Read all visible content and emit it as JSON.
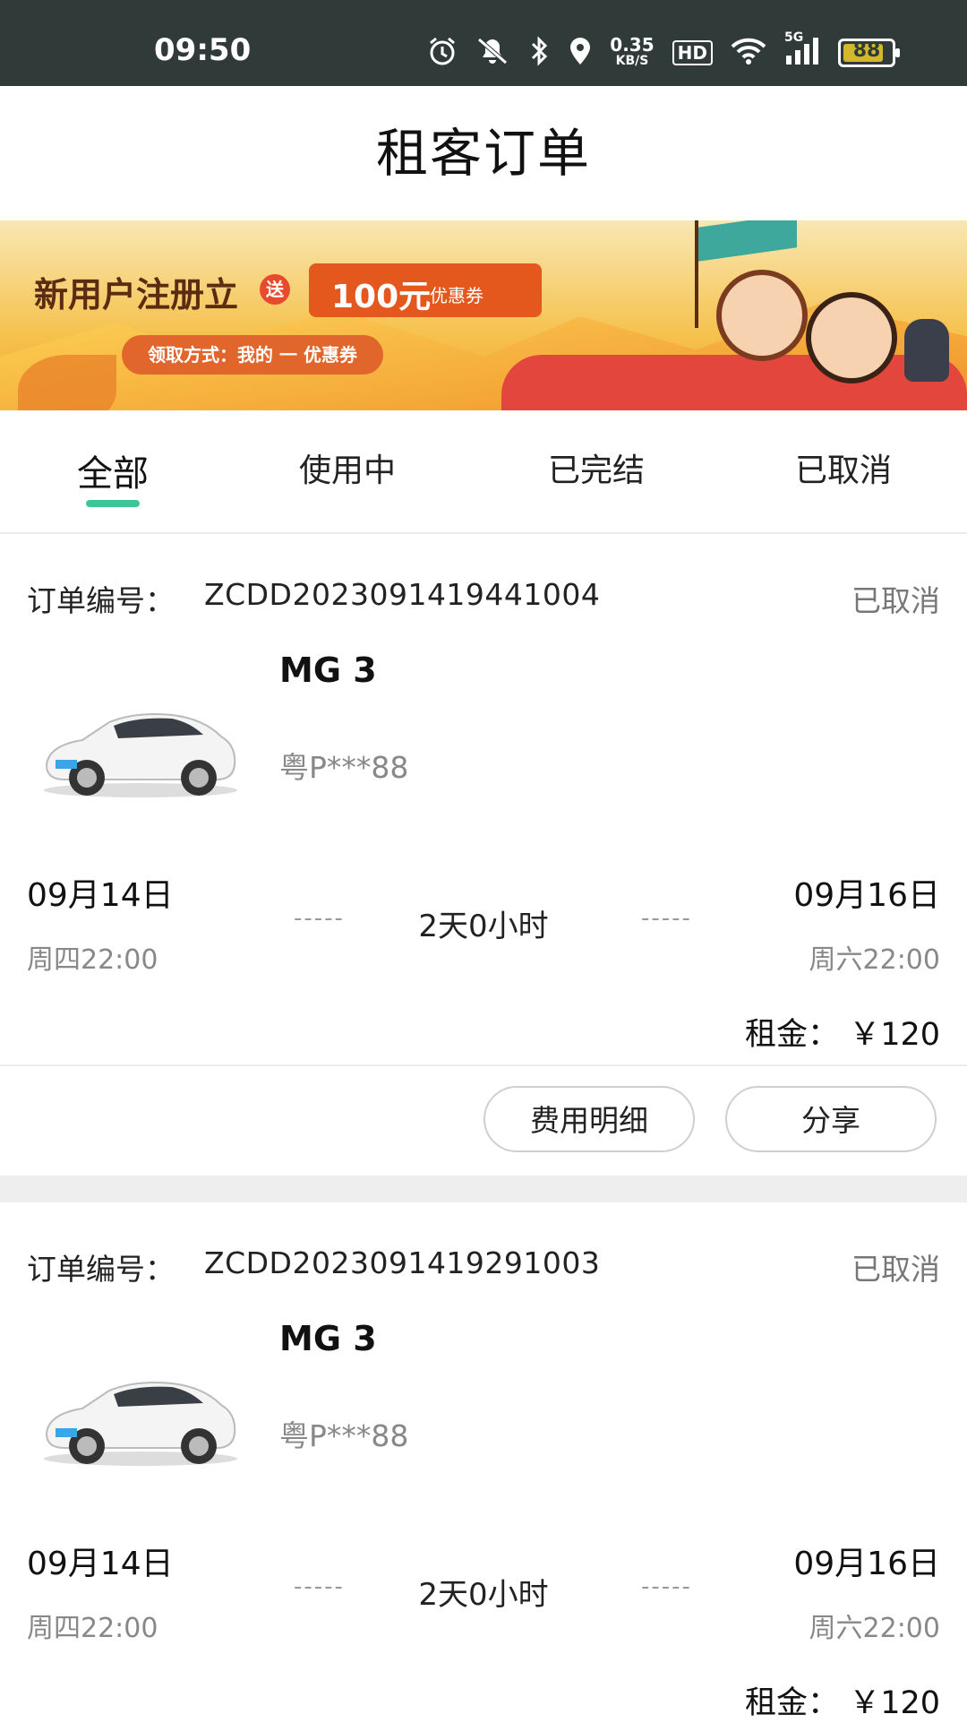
{
  "status_bar": {
    "time": "09:50",
    "net_speed_value": "0.35",
    "net_speed_unit": "KB/S",
    "hd_label": "HD",
    "signal_label": "5G",
    "battery": "88"
  },
  "header": {
    "title": "租客订单"
  },
  "banner": {
    "headline": "新用户注册立",
    "send_badge": "送",
    "amount": "100元",
    "amount_suffix": "优惠券",
    "how_to": "领取方式：我的 一 优惠券"
  },
  "tabs": [
    {
      "label": "全部",
      "active": true
    },
    {
      "label": "使用中",
      "active": false
    },
    {
      "label": "已完结",
      "active": false
    },
    {
      "label": "已取消",
      "active": false
    }
  ],
  "orders": [
    {
      "order_label": "订单编号：",
      "order_no": "ZCDD2023091419441004",
      "status": "已取消",
      "car_name": "MG 3",
      "plate": "粤P***88",
      "start_date": "09月14日",
      "start_time": "周四22:00",
      "end_date": "09月16日",
      "end_time": "周六22:00",
      "dash": "-----",
      "duration": "2天0小时",
      "rent_label": "租金：",
      "rent_value": "￥120",
      "btn_fee": "费用明细",
      "btn_share": "分享"
    },
    {
      "order_label": "订单编号：",
      "order_no": "ZCDD2023091419291003",
      "status": "已取消",
      "car_name": "MG 3",
      "plate": "粤P***88",
      "start_date": "09月14日",
      "start_time": "周四22:00",
      "end_date": "09月16日",
      "end_time": "周六22:00",
      "dash": "-----",
      "duration": "2天0小时",
      "rent_label": "租金：",
      "rent_value": "￥120"
    }
  ]
}
